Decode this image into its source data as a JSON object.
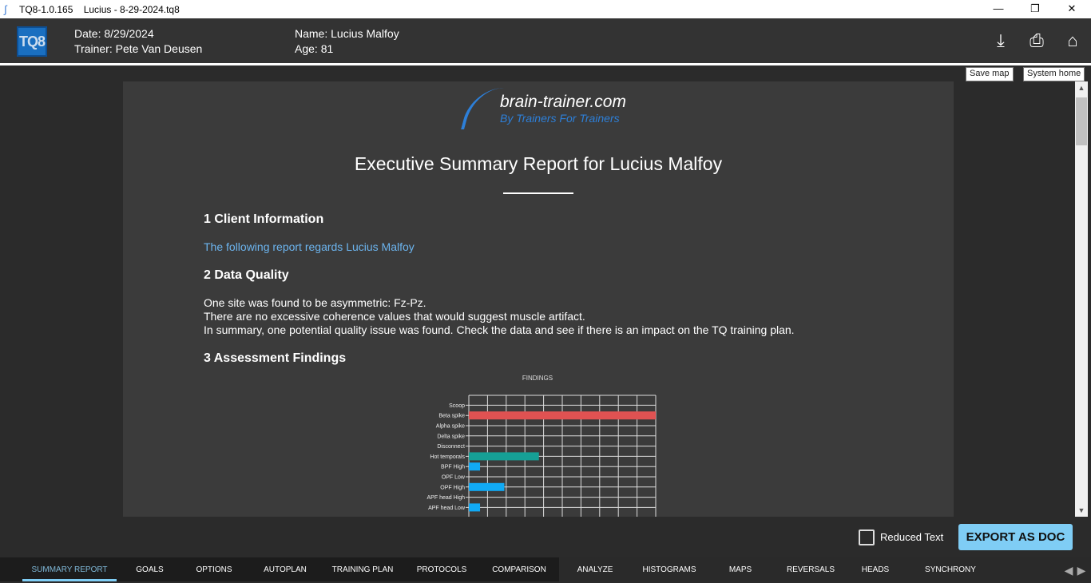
{
  "window": {
    "title": "TQ8-1.0.165    Lucius - 8-29-2024.tq8",
    "controls": [
      "minimize",
      "restore",
      "close"
    ]
  },
  "header": {
    "logo": "TQ8",
    "date": "Date: 8/29/2024",
    "trainer": "Trainer: Pete Van Deusen",
    "name": "Name: Lucius Malfoy",
    "age": "Age: 81",
    "icons": [
      {
        "name": "save-map-icon",
        "tooltip": "Save map"
      },
      {
        "name": "print-icon"
      },
      {
        "name": "home-icon",
        "tooltip": "System home"
      }
    ]
  },
  "report": {
    "brand": {
      "line1": "brain-trainer.com",
      "line2": "By Trainers For Trainers"
    },
    "title": "Executive Summary Report for Lucius Malfoy",
    "s1": {
      "heading": "1 Client Information",
      "text": "The following report regards Lucius Malfoy"
    },
    "s2": {
      "heading": "2 Data Quality",
      "lines": [
        "One site was found to be asymmetric: Fz-Pz.",
        "There are no excessive coherence values that would suggest muscle artifact.",
        "In summary, one potential quality issue was found. Check the data and see if there is an impact on the TQ training plan."
      ]
    },
    "s3": {
      "heading": "3 Assessment Findings"
    }
  },
  "chart_data": {
    "type": "bar",
    "orientation": "horizontal",
    "title": "FINDINGS",
    "grid": true,
    "xlim": [
      0,
      10
    ],
    "categories": [
      "Scoop",
      "Beta spike",
      "Alpha spike",
      "Delta spike",
      "Disconnect",
      "Hot temporals",
      "BPF High",
      "OPF Low",
      "OPF High",
      "APF head High",
      "APF head Low"
    ],
    "values": [
      0,
      10,
      0,
      0,
      0,
      3.75,
      0.6,
      0,
      1.9,
      0,
      0.6
    ],
    "colors": [
      "#e05252",
      "#e05252",
      "#e05252",
      "#e05252",
      "#e05252",
      "#16a096",
      "#11aaf5",
      "#11aaf5",
      "#11aaf5",
      "#11aaf5",
      "#11aaf5"
    ]
  },
  "footer": {
    "reduced_text": "Reduced Text",
    "reduced_checked": false,
    "export": "EXPORT AS DOC"
  },
  "tabs": [
    "SUMMARY REPORT",
    "GOALS",
    "OPTIONS",
    "AUTOPLAN",
    "TRAINING PLAN",
    "PROTOCOLS",
    "COMPARISON",
    "ANALYZE",
    "HISTOGRAMS",
    "MAPS",
    "REVERSALS",
    "HEADS",
    "SYNCHRONY"
  ],
  "active_tab": "SUMMARY REPORT"
}
